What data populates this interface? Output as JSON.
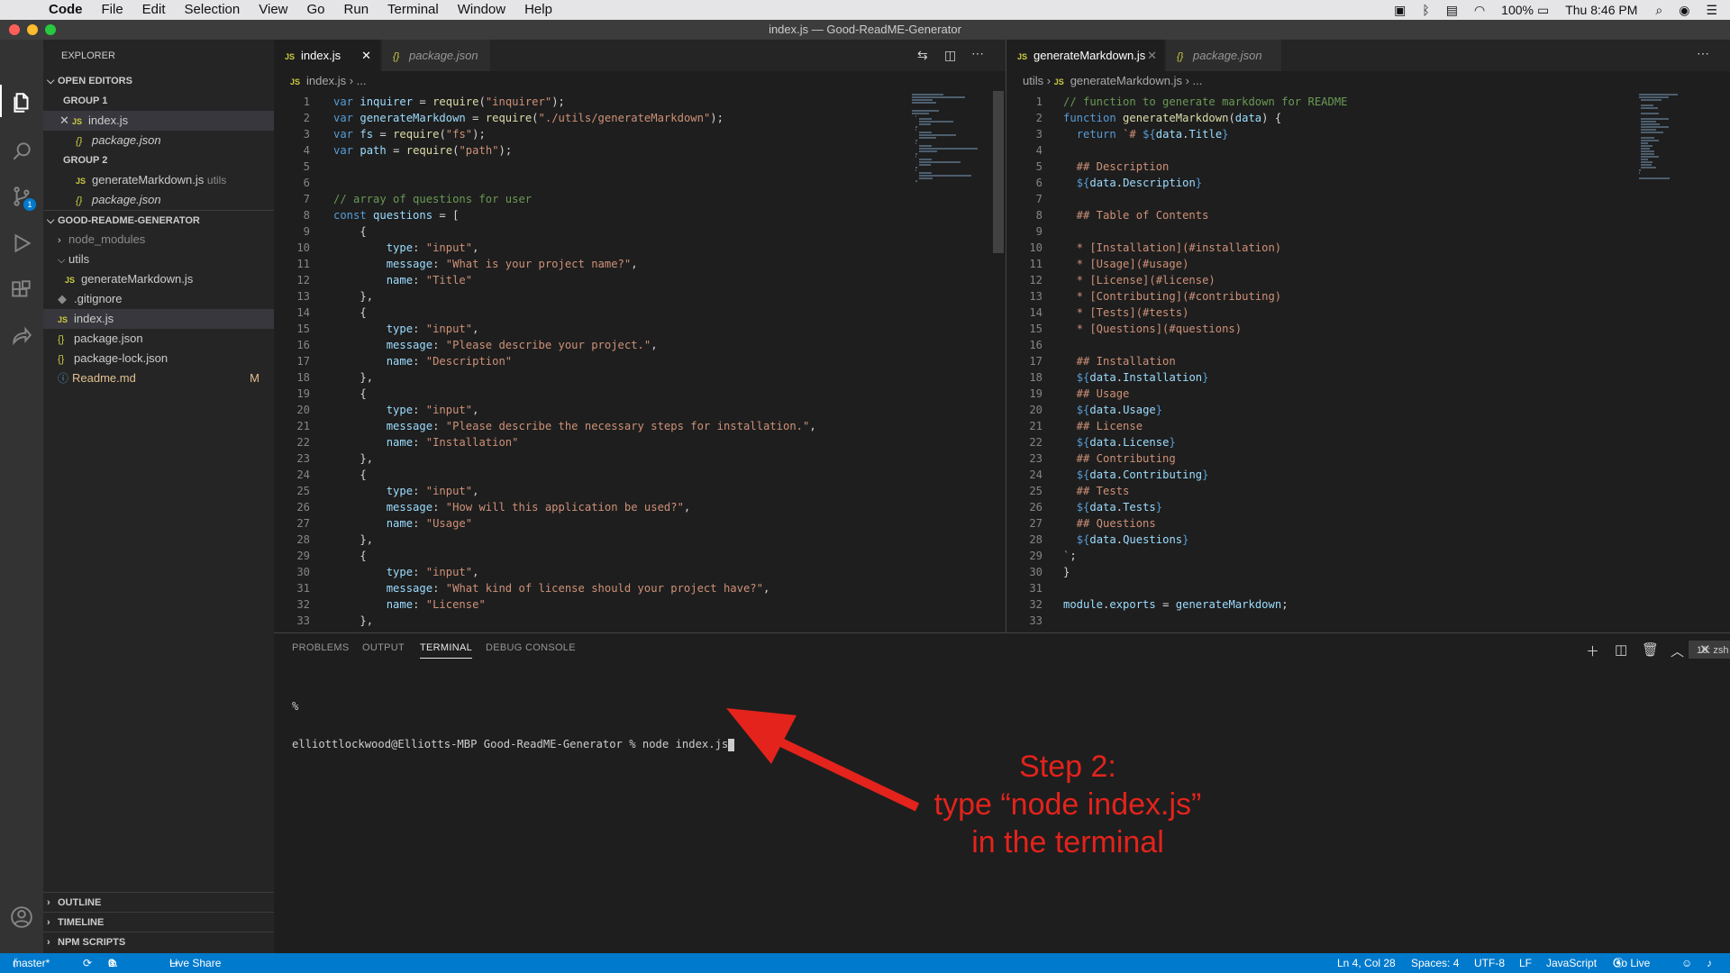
{
  "mac_menubar": {
    "apple": "",
    "app": "Code",
    "menus": [
      "File",
      "Edit",
      "Selection",
      "View",
      "Go",
      "Run",
      "Terminal",
      "Window",
      "Help"
    ],
    "battery": "100%",
    "clock": "Thu 8:46 PM"
  },
  "window": {
    "title": "index.js — Good-ReadME-Generator"
  },
  "explorer": {
    "header": "EXPLORER",
    "open_editors": "OPEN EDITORS",
    "group1": "GROUP 1",
    "group1_items": [
      "index.js",
      "package.json"
    ],
    "group2": "GROUP 2",
    "group2_items": [
      "generateMarkdown.js",
      "package.json"
    ],
    "group2_hint": "utils",
    "project": "GOOD-README-GENERATOR",
    "tree": {
      "node_modules": "node_modules",
      "utils": "utils",
      "utils_child": "generateMarkdown.js",
      "gitignore": ".gitignore",
      "index": "index.js",
      "package": "package.json",
      "package_lock": "package-lock.json",
      "readme": "Readme.md",
      "readme_badge": "M"
    },
    "outline": "OUTLINE",
    "timeline": "TIMELINE",
    "npm": "NPM SCRIPTS"
  },
  "left_editor": {
    "tabs": [
      "index.js",
      "package.json"
    ],
    "breadcrumb": [
      "index.js",
      "..."
    ]
  },
  "right_editor": {
    "tabs": [
      "generateMarkdown.js",
      "package.json"
    ],
    "breadcrumb": [
      "utils",
      "generateMarkdown.js",
      "..."
    ]
  },
  "left_code": [
    "var inquirer = require(\"inquirer\");",
    "var generateMarkdown = require(\"./utils/generateMarkdown\");",
    "var fs = require(\"fs\");",
    "var path = require(\"path\");",
    "",
    "",
    "// array of questions for user",
    "const questions = [",
    "    {",
    "        type: \"input\",",
    "        message: \"What is your project name?\",",
    "        name: \"Title\"",
    "    },",
    "    {",
    "        type: \"input\",",
    "        message: \"Please describe your project.\",",
    "        name: \"Description\"",
    "    },",
    "    {",
    "        type: \"input\",",
    "        message: \"Please describe the necessary steps for installation.\",",
    "        name: \"Installation\"",
    "    },",
    "    {",
    "        type: \"input\",",
    "        message: \"How will this application be used?\",",
    "        name: \"Usage\"",
    "    },",
    "    {",
    "        type: \"input\",",
    "        message: \"What kind of license should your project have?\",",
    "        name: \"License\"",
    "    },"
  ],
  "right_code": [
    "// function to generate markdown for README",
    "function generateMarkdown(data) {",
    "  return `# ${data.Title}",
    "",
    "  ## Description",
    "  ${data.Description}",
    "",
    "  ## Table of Contents",
    "",
    "  * [Installation](#installation)",
    "  * [Usage](#usage)",
    "  * [License](#license)",
    "  * [Contributing](#contributing)",
    "  * [Tests](#tests)",
    "  * [Questions](#questions)",
    "",
    "  ## Installation",
    "  ${data.Installation}",
    "  ## Usage",
    "  ${data.Usage}",
    "  ## License",
    "  ${data.License}",
    "  ## Contributing",
    "  ${data.Contributing}",
    "  ## Tests",
    "  ${data.Tests}",
    "  ## Questions",
    "  ${data.Questions}",
    "`;",
    "}",
    "",
    "module.exports = generateMarkdown;",
    ""
  ],
  "panel": {
    "tabs": [
      "PROBLEMS",
      "OUTPUT",
      "TERMINAL",
      "DEBUG CONSOLE"
    ],
    "terminal_select": "10: zsh",
    "prompt": "elliottlockwood@Elliotts-MBP Good-ReadME-Generator % node index.js"
  },
  "annotation": {
    "line1": "Step 2:",
    "line2": "type “node index.js”",
    "line3": "in the terminal"
  },
  "statusbar": {
    "branch": "master*",
    "errors": "0",
    "warnings": "0",
    "live_share": "Live Share",
    "position": "Ln 4, Col 28",
    "spaces": "Spaces: 4",
    "encoding": "UTF-8",
    "eol": "LF",
    "language": "JavaScript",
    "go_live": "Go Live"
  },
  "colors": {
    "accent": "#007acc",
    "annotation": "#e3231c"
  }
}
